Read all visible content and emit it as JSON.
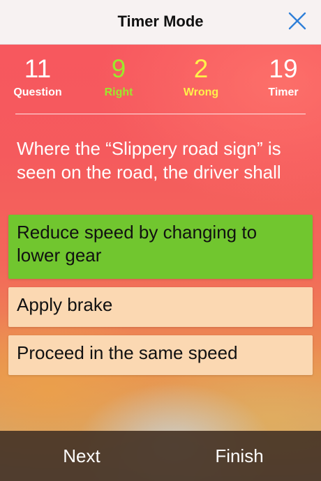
{
  "header": {
    "title": "Timer Mode",
    "close_icon": "close-icon"
  },
  "stats": {
    "question": {
      "value": "11",
      "label": "Question"
    },
    "right": {
      "value": "9",
      "label": "Right",
      "color": "#9ce82c"
    },
    "wrong": {
      "value": "2",
      "label": "Wrong",
      "color": "#fff14a"
    },
    "timer": {
      "value": "19",
      "label": "Timer"
    }
  },
  "question_text": "Where the “Slippery road sign” is seen on the road, the driver shall",
  "options": [
    {
      "label": "Reduce speed by changing to lower gear",
      "state": "correct",
      "color": "#71c62f"
    },
    {
      "label": "Apply brake",
      "state": "normal",
      "color": "#fbd8b2"
    },
    {
      "label": "Proceed in the same speed",
      "state": "normal",
      "color": "#fbd8b2"
    }
  ],
  "footer": {
    "next_label": "Next",
    "finish_label": "Finish"
  },
  "colors": {
    "accent": "#2f7fd8",
    "header_bg": "#f7f2f2",
    "footer_bg": "#463426"
  }
}
